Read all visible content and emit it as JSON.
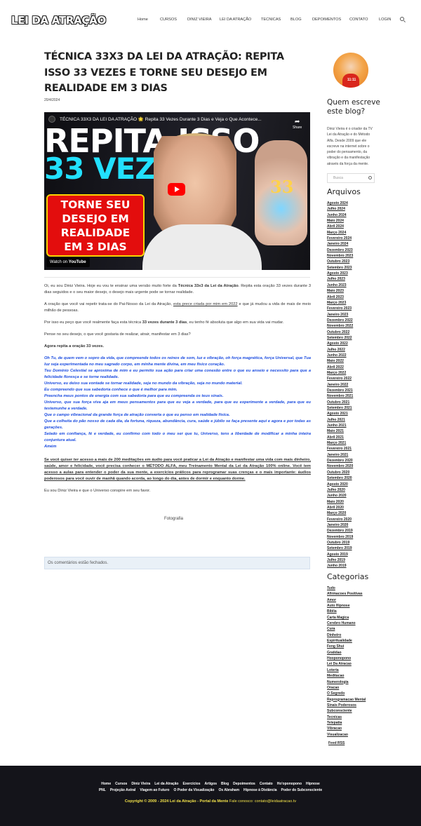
{
  "brand": {
    "logo": "LEI DA ATRAÇÃO"
  },
  "nav": [
    "Home",
    "CURSOS",
    "DINIZ VIEIRA",
    "LEI DA ATRAÇÃO",
    "TECNICAS",
    "BLOG",
    "DEPOIMENTOS",
    "CONTATO",
    "LOGIN"
  ],
  "article": {
    "title": "TÉCNICA 33X3 DA LEI DA ATRAÇÃO: REPITA ISSO 33 VEZES E TORNE SEU DESEJO EM REALIDADE EM 3 DIAS",
    "date": "20/4/2024",
    "video": {
      "title": "TÉCNICA 33X3 DA LEI DA ATRAÇÃO 🌟 Repita 33 Vezes Durante 3 Dias e Veja o Que Acontece...",
      "share": "Share",
      "watch_on": "Watch on",
      "youtube": "YouTube",
      "thumb_line1": "REPITA ISSO",
      "thumb_line2": "33 VEZES",
      "thumb_box": [
        "TORNE SEU",
        "DESEJO EM",
        "REALIDADE",
        "EM 3 DIAS"
      ],
      "thumb_symbol": "33"
    },
    "p1_a": "Oi, eu sou Diniz Vieira. Hoje eu vou te ensinar uma versão muito forte da ",
    "p1_b": "Técnica 33x3 da Lei da Atração",
    "p1_c": ". Repita esta oração 33 vezes durante 3 dias seguidos e o seu maior desejo, o desejo mais urgente pode se tornar realidade.",
    "p2_a": "A oração que você vai repetir trata-se do Pai-Nosso da Lei da Atração, ",
    "p2_b": "esta prece criada por mim em 2022",
    "p2_c": " e que já mudou a vida de mais de meio milhão de pessoas.",
    "p3_a": "Por isso eu peço que você realmente faça esta técnica ",
    "p3_b": "33 vezes durante 3 dias",
    "p3_c": ", eu tenho fé absoluta que algo em sua vida vai mudar.",
    "p4": "Pense no seu desejo, o que você gostaria de realizar, atrair, manifestar em 3 dias?",
    "p5": "Agora repita a oração 33 vezes.",
    "prayer": [
      "Oh Tu, de quem vem o sopro da vida, que compreende todos os reinos de som, luz e vibração, oh força magnética, força Universal, que Tua luz seja experimentada no meu sagrado corpo, em minha mente divina, em meu físico coração.",
      "Teu Domínio Celestial se aproxima de mim e eu permito sua ação para criar uma conexão entre o que eu anseio e necessito para que a felicidade floresça e se torne realidade.",
      "Universo, eu deixo sua vontade se tornar realidade, seja no mundo da vibração, seja no mundo material.",
      "Eu compreendo que sua sabedoria conhece o que é melhor para mim.",
      "Preencha meus pontos de energia com sua sabedoria para que eu compreenda os teus sinais.",
      "Universo, que sua força viva aja em meus pensamentos para que eu veja a verdade, para que eu experimente a verdade, para que eu testemunhe a verdade.",
      "Que o campo vibracional da grande força de atração converta o que eu penso em realidade física.",
      "Que a colheita do pão nosso de cada dia, da fortuna, riqueza, abundância, cura, saúde e júbilo se faça presente aqui e agora e por todas as gerações.",
      "Selado em confiança, fé e verdade, eu confirmo com todo o meu ser que tu, Universo, tens a liberdade de modificar a minha inteira conjuntura atual.",
      "Amém"
    ],
    "promo": "Se você quiser ter acesso a mais de 200 meditações em áudio para você praticar a Lei da Atração e manifestar uma vida com mais dinheiro, saúde, amor e felicidade, você precisa conhecer o MÉTODO ALFA, meu Treinamento Mental da Lei da Atração 100% online. Você tem acesso a aulas para entender o poder da sua mente, a exercícios práticos para reprogramar suas crenças e o mais importante: áudios poderosos para você ouvir de manhã quando acorda, ao longo do dia, antes de dormir e enquanto dorme.",
    "sign": "Eu sou Diniz Vieira e que o Universo conspire em seu favor.",
    "photo_alt": "Fotografia",
    "comments": "Os comentários estão fechados."
  },
  "sidebar": {
    "avatar_tag": "11:11",
    "about_title": "Quem escreve este blog?",
    "about_text": "Diniz Vieira é o criador da TV Lei da Atração e do Método Alfa. Desde 2009 que ele escreve na internet sobre o poder do pensamento, da vibração e da manifestação através da força da mente.",
    "search_placeholder": "Busca",
    "archives_title": "Arquivos",
    "archives": [
      "Agosto 2024",
      "Julho 2024",
      "Junho 2024",
      "Maio 2024",
      "Abril 2024",
      "Março 2024",
      "Fevereiro 2024",
      "Janeiro 2024",
      "Dezembro 2023",
      "Novembro 2023",
      "Outubro 2023",
      "Setembro 2023",
      "Agosto 2023",
      "Julho 2023",
      "Junho 2023",
      "Maio 2023",
      "Abril 2023",
      "Março 2023",
      "Fevereiro 2023",
      "Janeiro 2023",
      "Dezembro 2022",
      "Novembro 2022",
      "Outubro 2022",
      "Setembro 2022",
      "Agosto 2022",
      "Julho 2022",
      "Junho 2022",
      "Maio 2022",
      "Abril 2022",
      "Março 2022",
      "Fevereiro 2022",
      "Janeiro 2022",
      "Dezembro 2021",
      "Novembro 2021",
      "Outubro 2021",
      "Setembro 2021",
      "Agosto 2021",
      "Julho 2021",
      "Junho 2021",
      "Maio 2021",
      "Abril 2021",
      "Março 2021",
      "Fevereiro 2021",
      "Janeiro 2021",
      "Dezembro 2020",
      "Novembro 2020",
      "Outubro 2020",
      "Setembro 2020",
      "Agosto 2020",
      "Julho 2020",
      "Junho 2020",
      "Maio 2020",
      "Abril 2020",
      "Março 2020",
      "Fevereiro 2020",
      "Janeiro 2020",
      "Dezembro 2019",
      "Novembro 2019",
      "Outubro 2019",
      "Setembro 2019",
      "Agosto 2019",
      "Julho 2019",
      "Junho 2019"
    ],
    "categories_title": "Categorias",
    "categories": [
      "Tudo",
      "Afirmacoes Positivas",
      "Amor",
      "Auto Hipnose",
      "Bíblia",
      "Carta Magica",
      "Cerebro Humano",
      "Cura",
      "Dinheiro",
      "Espiritualidade",
      "Feng Shui",
      "Gratidao",
      "Hooponopono",
      "Lei Da Atracao",
      "Loteria",
      "Meditacao",
      "Numerologia",
      "Oracao",
      "O Segredo",
      "Reprogramacao Mental",
      "Sinais Poderosos",
      "Subconsciente",
      "Tecnicas",
      "Telepatia",
      "Vibracao",
      "Visualizacao"
    ],
    "feed": "Feed RSS"
  },
  "footer": {
    "row1": [
      "Home",
      "Cursos",
      "Diniz Vieira",
      "Lei da Atração",
      "Exercícios",
      "Artigos",
      "Blog",
      "Depoimentos",
      "Contato",
      "Ho'oponopono",
      "Hipnose"
    ],
    "row2": [
      "PNL",
      "Projeção Astral",
      "Viagem ao Futuro",
      "O Poder da Visualização",
      "Os Abraham",
      "Hipnose à Distância",
      "Poder do Subconsciente"
    ],
    "copyright": "Copyright © 2009 - 2024 Lei da Atração - Portal da Mente",
    "contact": " Fale conosco: contato@leidaatracao.tv"
  }
}
